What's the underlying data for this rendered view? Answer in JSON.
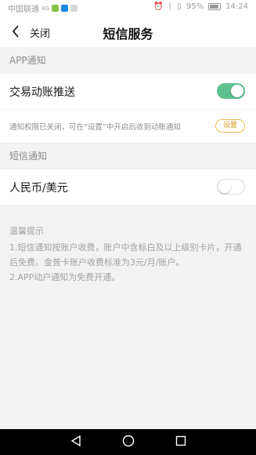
{
  "status_bar": {
    "carrier": "中国联通",
    "signal_label": "4G",
    "battery_percent": "95%",
    "time": "14:24"
  },
  "nav": {
    "close_label": "关闭",
    "title": "短信服务"
  },
  "app_section": {
    "header": "APP通知",
    "push_label": "交易动账推送",
    "push_enabled": true,
    "hint_text": "通知权限已关闭，可在“设置”中开启后收到动账通知",
    "settings_button": "设置"
  },
  "sms_section": {
    "header": "短信通知",
    "rmb_usd_label": "人民币/美元",
    "rmb_usd_enabled": false
  },
  "tips": {
    "title": "温馨提示",
    "line1": "1.短信通知按账户收费，账户中含标白及以上级别卡片，开通后免费。金普卡账户收费标准为3元/月/账户。",
    "line2": "2.APP动户通知为免费开通。"
  },
  "colors": {
    "accent_green": "#5ec08e",
    "settings_gold": "#d19a21"
  }
}
